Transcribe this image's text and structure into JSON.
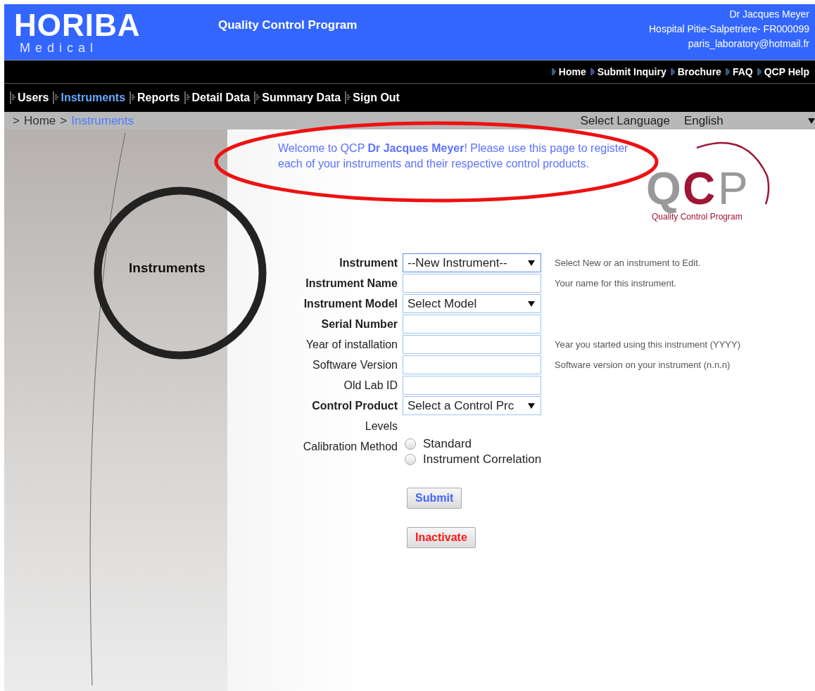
{
  "header": {
    "brand": "HORIBA",
    "brand_sub": "Medical",
    "program": "Quality Control Program",
    "user": [
      "Dr Jacques Meyer",
      "Hospital Pitie-Salpetriere- FR000099",
      "paris_laboratory@hotmail.fr"
    ]
  },
  "top_links": [
    "Home",
    "Submit Inquiry",
    "Brochure",
    "FAQ",
    "QCP Help"
  ],
  "nav": [
    {
      "label": "Users",
      "selected": false
    },
    {
      "label": "Instruments",
      "selected": true
    },
    {
      "label": "Reports",
      "selected": false
    },
    {
      "label": "Detail Data",
      "selected": false
    },
    {
      "label": "Summary Data",
      "selected": false
    },
    {
      "label": "Sign Out",
      "selected": false
    }
  ],
  "breadcrumb": [
    {
      "separator": ">",
      "label": "Home",
      "selected": false
    },
    {
      "separator": ">",
      "label": "Instruments",
      "selected": true
    }
  ],
  "language": {
    "label": "Select Language",
    "value": "English"
  },
  "side_title": "Instruments",
  "welcome": "Welcome to QCP **Dr Jacques Meyer**! Please use this page to register each of your instruments and their respective control products.",
  "logo": {
    "letters": [
      "Q",
      "C",
      "P"
    ],
    "caption": "Quality Control Program"
  },
  "form": [
    {
      "label": "Instrument",
      "required": true,
      "kind": "select",
      "value": "--New Instrument--",
      "focused": true,
      "hint": "Select New or an instrument to Edit."
    },
    {
      "label": "Instrument Name",
      "required": true,
      "kind": "input",
      "focused": false,
      "hint": "Your name for this instrument."
    },
    {
      "label": "Instrument Model",
      "required": true,
      "kind": "select",
      "value": "Select Model",
      "focused": false
    },
    {
      "label": "Serial Number",
      "required": true,
      "kind": "input",
      "focused": false
    },
    {
      "label": "Year of installation",
      "required": false,
      "kind": "input",
      "focused": false,
      "hint": "Year you started using this instrument (YYYY)"
    },
    {
      "label": "Software Version",
      "required": false,
      "kind": "input",
      "focused": false,
      "hint": "Software version on your instrument (n.n.n)"
    },
    {
      "label": "Old Lab ID",
      "required": false,
      "kind": "input",
      "focused": false
    },
    {
      "label": "Control Product",
      "required": true,
      "kind": "select",
      "value": "Select a Control Prc",
      "focused": false
    },
    {
      "label": "Levels",
      "required": false,
      "kind": "none"
    }
  ],
  "calibration": {
    "label": "Calibration Method",
    "options": [
      {
        "label": "Standard",
        "selected": false
      },
      {
        "label": "Instrument Correlation",
        "selected": false
      }
    ]
  },
  "buttons": [
    {
      "label": "Submit",
      "kind": "primary"
    },
    {
      "label": "Inactivate",
      "kind": "danger"
    }
  ]
}
